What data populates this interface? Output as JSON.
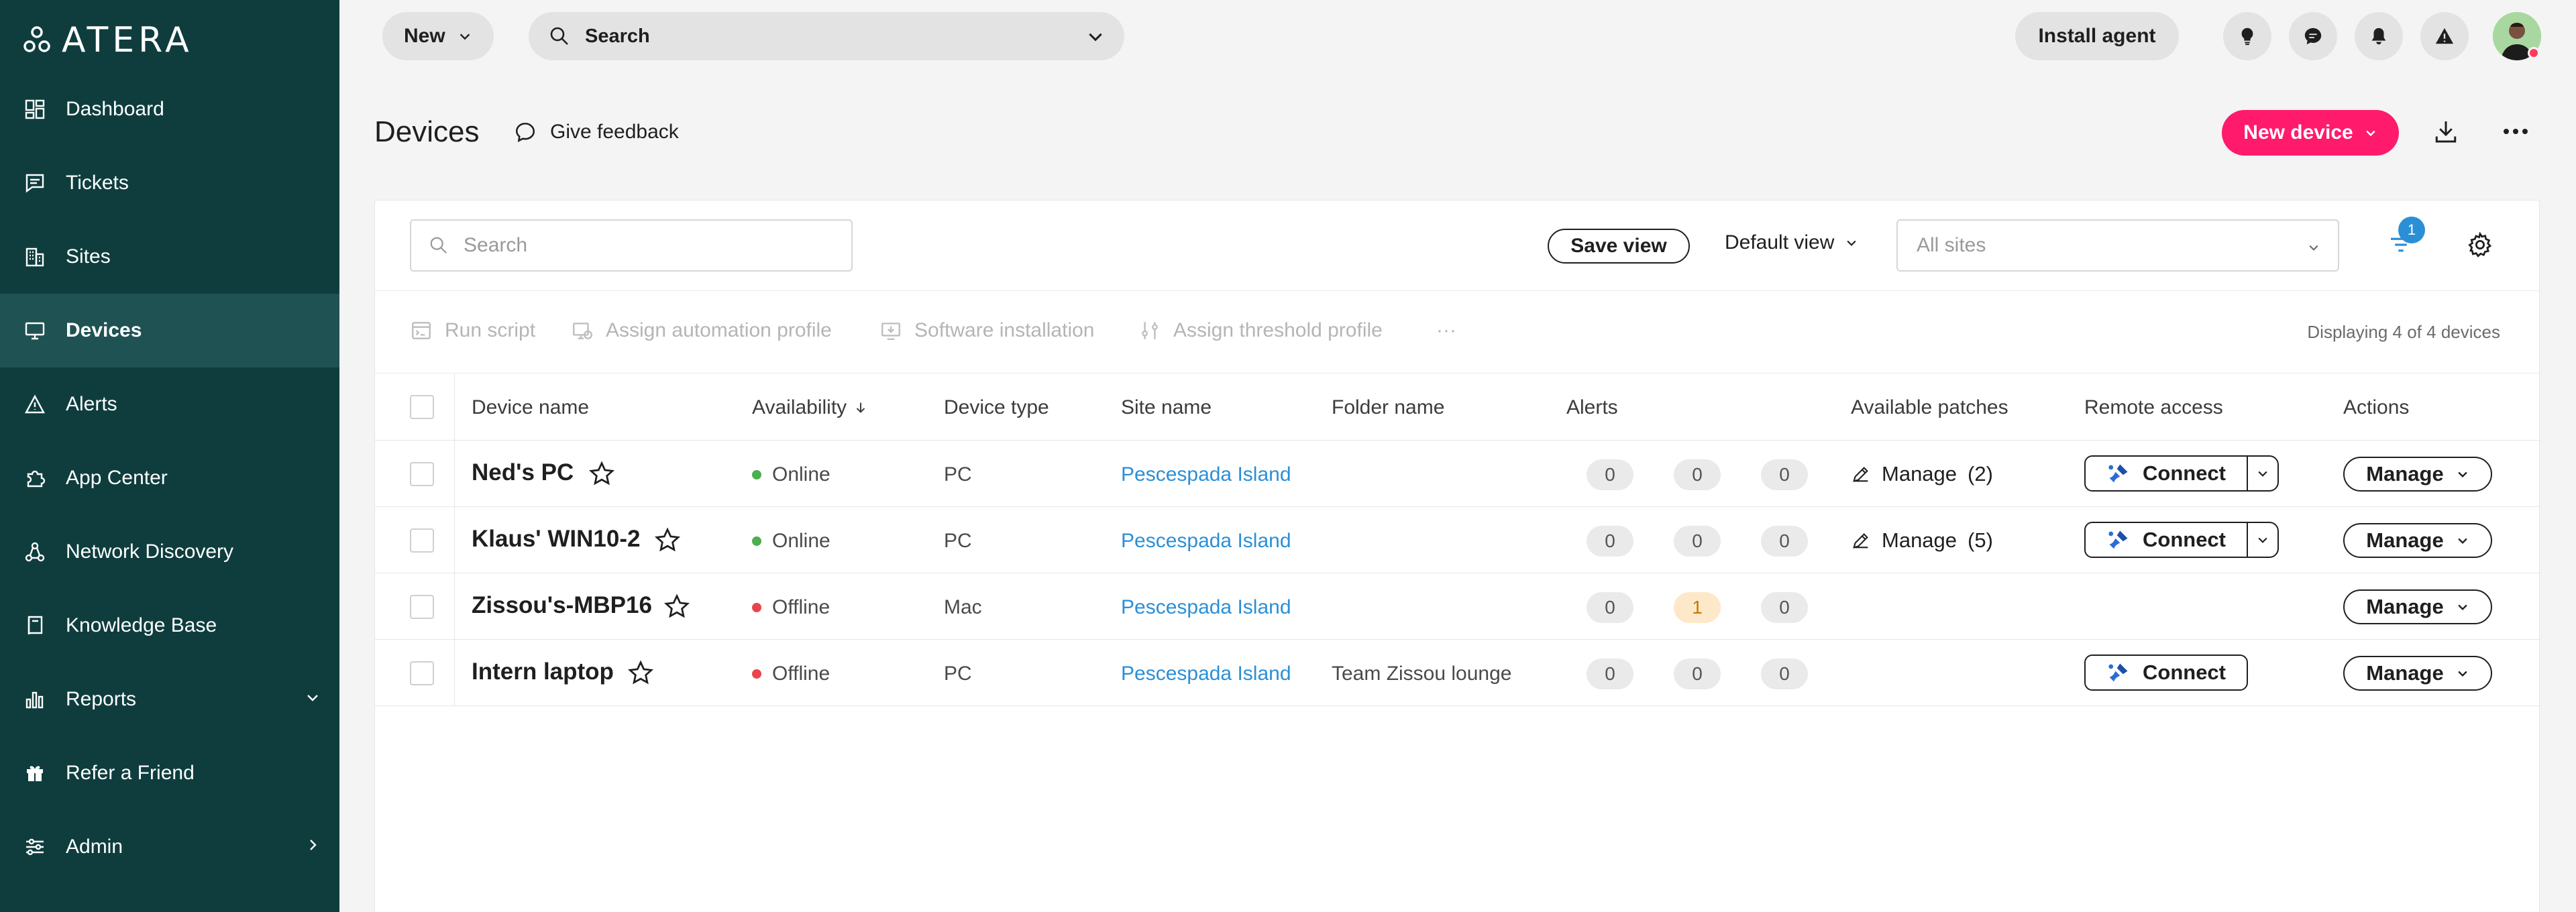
{
  "brand": {
    "name": "ATERA"
  },
  "sidebar": {
    "items": [
      {
        "label": "Dashboard",
        "icon": "dashboard-icon"
      },
      {
        "label": "Tickets",
        "icon": "tickets-icon"
      },
      {
        "label": "Sites",
        "icon": "sites-icon"
      },
      {
        "label": "Devices",
        "icon": "devices-icon",
        "active": true
      },
      {
        "label": "Alerts",
        "icon": "alert-icon"
      },
      {
        "label": "App Center",
        "icon": "puzzle-icon"
      },
      {
        "label": "Network Discovery",
        "icon": "network-icon"
      },
      {
        "label": "Knowledge Base",
        "icon": "book-icon"
      },
      {
        "label": "Reports",
        "icon": "reports-icon",
        "chevron": "down"
      },
      {
        "label": "Refer a Friend",
        "icon": "gift-icon"
      },
      {
        "label": "Admin",
        "icon": "sliders-icon",
        "chevron": "right"
      }
    ]
  },
  "topbar": {
    "new_label": "New",
    "search_label": "Search",
    "install_label": "Install agent",
    "icons": [
      "lightbulb-icon",
      "chat-icon",
      "bell-icon",
      "warning-icon"
    ]
  },
  "page": {
    "title": "Devices",
    "feedback_label": "Give feedback",
    "new_device_label": "New device"
  },
  "card": {
    "search_placeholder": "Search",
    "save_view_label": "Save view",
    "default_view_label": "Default view",
    "sites_placeholder": "All sites",
    "filter_count": "1",
    "toolbar": {
      "run_script": "Run script",
      "assign_automation": "Assign automation profile",
      "software_installation": "Software installation",
      "assign_threshold": "Assign threshold profile",
      "more": "···"
    },
    "displaying": "Displaying 4 of 4 devices"
  },
  "table": {
    "headers": {
      "device_name": "Device name",
      "availability": "Availability",
      "device_type": "Device type",
      "site_name": "Site name",
      "folder_name": "Folder name",
      "alerts": "Alerts",
      "available_patches": "Available patches",
      "remote_access": "Remote access",
      "actions": "Actions"
    },
    "rows": [
      {
        "name": "Ned's PC",
        "availability": "Online",
        "status_color": "#4caf50",
        "type": "PC",
        "site": "Pescespada Island",
        "folder": "",
        "alerts": [
          "0",
          "0",
          "0"
        ],
        "patch_label": "Manage",
        "patch_count": "(2)",
        "connect_label": "Connect",
        "manage_label": "Manage"
      },
      {
        "name": "Klaus' WIN10-2",
        "availability": "Online",
        "status_color": "#4caf50",
        "type": "PC",
        "site": "Pescespada Island",
        "folder": "",
        "alerts": [
          "0",
          "0",
          "0"
        ],
        "patch_label": "Manage",
        "patch_count": "(5)",
        "connect_label": "Connect",
        "manage_label": "Manage"
      },
      {
        "name": "Zissou's-MBP16",
        "availability": "Offline",
        "status_color": "#e8454a",
        "type": "Mac",
        "site": "Pescespada Island",
        "folder": "",
        "alerts": [
          "0",
          "1",
          "0"
        ],
        "patch_label": "",
        "patch_count": "",
        "connect_label": "",
        "manage_label": "Manage"
      },
      {
        "name": "Intern laptop",
        "availability": "Offline",
        "status_color": "#e8454a",
        "type": "PC",
        "site": "Pescespada Island",
        "folder": "Team Zissou lounge",
        "alerts": [
          "0",
          "0",
          "0"
        ],
        "patch_label": "",
        "patch_count": "",
        "connect_label": "Connect",
        "manage_label": "Manage"
      }
    ]
  },
  "colors": {
    "sidebar_bg": "#0f3d3e",
    "sidebar_active": "#1f5253",
    "accent_pink": "#ff1a6c",
    "link_blue": "#2b8fd6",
    "online_green": "#4caf50",
    "offline_red": "#e8454a"
  }
}
